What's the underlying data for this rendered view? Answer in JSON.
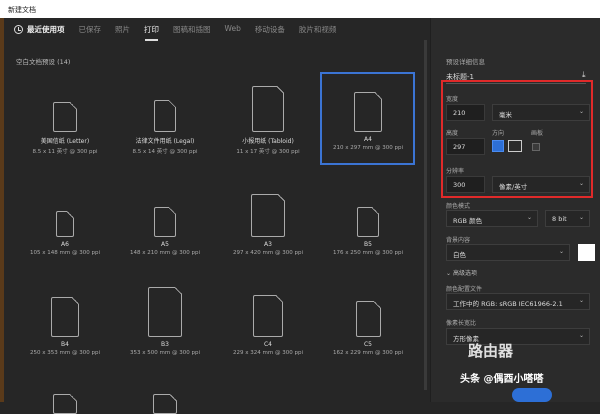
{
  "window_title": "新建文档",
  "tabs": [
    {
      "label": "最近使用项"
    },
    {
      "label": "已保存"
    },
    {
      "label": "照片"
    },
    {
      "label": "打印"
    },
    {
      "label": "图稿和插图"
    },
    {
      "label": "Web"
    },
    {
      "label": "移动设备"
    },
    {
      "label": "胶片和视频"
    }
  ],
  "active_tab": "打印",
  "section_title": "空白文档预设 (14)",
  "presets": [
    {
      "name": "美国信纸 (Letter)",
      "dims": "8.5 x 11 英寸 @ 300 ppi"
    },
    {
      "name": "法律文件用纸 (Legal)",
      "dims": "8.5 x 14 英寸 @ 300 ppi"
    },
    {
      "name": "小报用纸 (Tabloid)",
      "dims": "11 x 17 英寸 @ 300 ppi"
    },
    {
      "name": "A4",
      "dims": "210 x 297 mm @ 300 ppi",
      "selected": true
    },
    {
      "name": "A6",
      "dims": "105 x 148 mm @ 300 ppi"
    },
    {
      "name": "A5",
      "dims": "148 x 210 mm @ 300 ppi"
    },
    {
      "name": "A3",
      "dims": "297 x 420 mm @ 300 ppi"
    },
    {
      "name": "B5",
      "dims": "176 x 250 mm @ 300 ppi"
    },
    {
      "name": "B4",
      "dims": "250 x 353 mm @ 300 ppi"
    },
    {
      "name": "B3",
      "dims": "353 x 500 mm @ 300 ppi"
    },
    {
      "name": "C4",
      "dims": "229 x 324 mm @ 300 ppi"
    },
    {
      "name": "C5",
      "dims": "162 x 229 mm @ 300 ppi"
    }
  ],
  "details": {
    "title": "预设详细信息",
    "doc_name": "未标题-1",
    "width_label": "宽度",
    "width": "210",
    "width_unit": "毫米",
    "height_label": "高度",
    "height": "297",
    "orientation_label": "方向",
    "orientation": "portrait",
    "artboard_label": "画板",
    "resolution_label": "分辨率",
    "resolution": "300",
    "resolution_unit": "像素/英寸",
    "color_mode_label": "颜色模式",
    "color_mode": "RGB 颜色",
    "bit_depth": "8 bit",
    "background_label": "背景内容",
    "background": "白色",
    "background_color": "#ffffff",
    "advanced_label": "高级选项",
    "color_profile_label": "颜色配置文件",
    "color_profile": "工作中的 RGB: sRGB IEC61966-2.1",
    "pixel_aspect_label": "像素长宽比",
    "pixel_aspect": "方形像素"
  },
  "watermark": {
    "brand": "路由器",
    "sub": "头条 @偶酉小嗒嗒"
  },
  "colors": {
    "accent": "#3b74d4",
    "highlight": "#e02a2a"
  }
}
